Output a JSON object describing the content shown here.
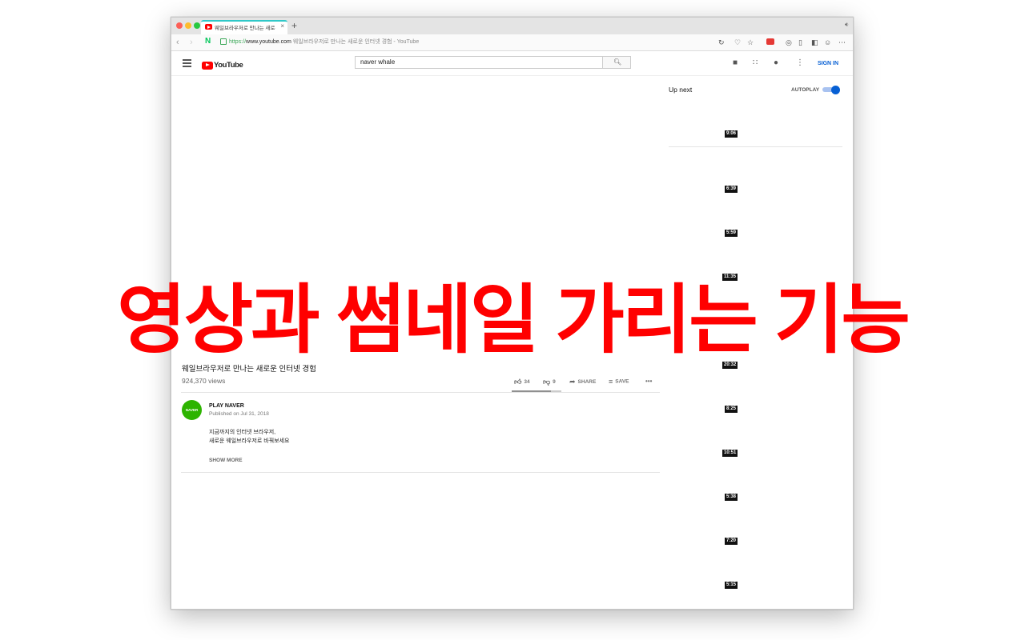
{
  "browser": {
    "tab_title": "웨일브라우저로 만나는 새로운",
    "tab_close": "×",
    "new_tab": "+",
    "url_scheme": "https://",
    "url_host": "www.youtube.com",
    "url_page_title": "웨일브라우저로 만나는 새로운 인터넷 경험 - YouTube",
    "logo_letter": "N"
  },
  "youtube": {
    "logo_text": "YouTube",
    "search_value": "naver whale",
    "sign_in": "SIGN IN"
  },
  "video": {
    "title": "웨일브라우저로 만나는 새로운 인터넷 경험",
    "views": "924,370 views",
    "likes": "34",
    "dislikes": "9",
    "share_label": "SHARE",
    "save_label": "SAVE",
    "more": "•••",
    "sentiment_like_fraction": 0.79
  },
  "channel": {
    "avatar_text": "NAVER",
    "name": "PLAY NAVER",
    "published": "Published on Jul 31, 2018",
    "description_line1": "지금까지의 인터넷 브라우저,",
    "description_line2": "새로운 웨일브라우저로 바꿔보세요",
    "show_more": "SHOW MORE"
  },
  "up_next": {
    "label": "Up next",
    "autoplay_label": "AUTOPLAY",
    "autoplay_on": true,
    "durations": [
      "9:06",
      "6:39",
      "5:59",
      "11:35",
      "20:32",
      "8:25",
      "10:51",
      "5:38",
      "7:20",
      "5:15"
    ]
  },
  "overlay": {
    "caption": "영상과 썸네일 가리는 기능",
    "color": "#ff0000"
  },
  "colors": {
    "youtube_red": "#ff0000",
    "sign_in_blue": "#065fd4",
    "naver_green": "#2db400"
  }
}
